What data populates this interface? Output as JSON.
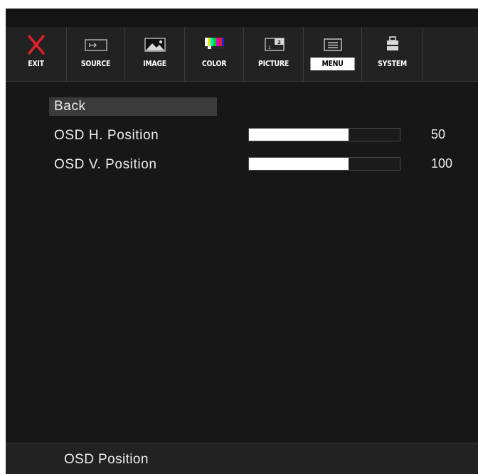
{
  "tabs": [
    {
      "label": "EXIT",
      "icon": "close-x-icon"
    },
    {
      "label": "SOURCE",
      "icon": "source-input-icon"
    },
    {
      "label": "IMAGE",
      "icon": "image-icon"
    },
    {
      "label": "COLOR",
      "icon": "color-bars-icon"
    },
    {
      "label": "PICTURE",
      "icon": "picture-in-picture-icon"
    },
    {
      "label": "MENU",
      "icon": "menu-icon"
    },
    {
      "label": "SYSTEM",
      "icon": "system-icon"
    }
  ],
  "active_tab": "MENU",
  "items": [
    {
      "label": "Back"
    },
    {
      "label": "OSD H. Position",
      "value": "50",
      "fill_fraction": 0.66
    },
    {
      "label": "OSD V. Position",
      "value": "100",
      "fill_fraction": 0.66
    }
  ],
  "footer": {
    "text": "OSD Position"
  },
  "colors": {
    "exit_icon": "#e0202a",
    "panel_bg": "#171717",
    "tab_bar_bg": "#222222",
    "highlight": "#3b3b3b",
    "fill": "#ffffff"
  }
}
